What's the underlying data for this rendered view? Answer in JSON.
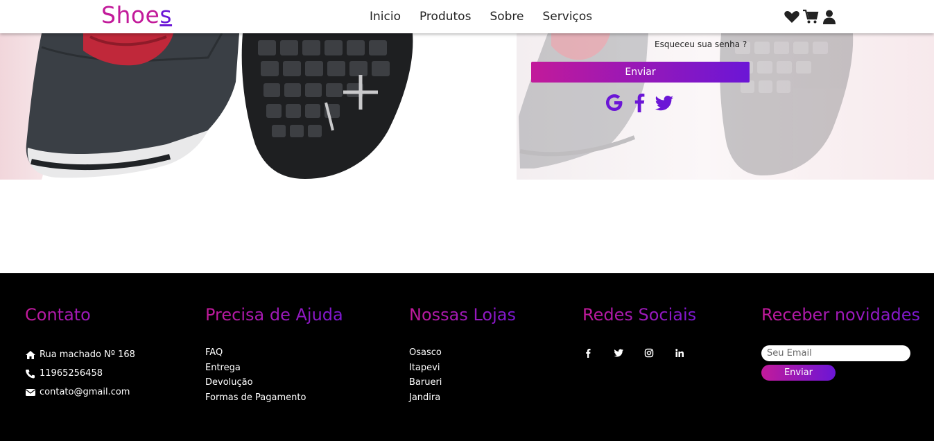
{
  "header": {
    "logo_main": "Shoe",
    "logo_last": "s",
    "nav": [
      "Inicio",
      "Produtos",
      "Sobre",
      "Serviços"
    ],
    "icons": [
      "heart-icon",
      "cart-icon",
      "user-icon"
    ]
  },
  "login": {
    "forgot_password": "Esqueceu sua senha ?",
    "submit_label": "Enviar",
    "social_icons": [
      "google-icon",
      "facebook-icon",
      "twitter-icon"
    ]
  },
  "footer": {
    "contact": {
      "title": "Contato",
      "address": "Rua machado Nº 168",
      "phone": "11965256458",
      "email": "contato@gmail.com"
    },
    "help": {
      "title": "Precisa de Ajuda",
      "items": [
        "FAQ",
        "Entrega",
        "Devolução",
        "Formas de Pagamento"
      ]
    },
    "stores": {
      "title": "Nossas Lojas",
      "items": [
        "Osasco",
        "Itapevi",
        "Barueri",
        "Jandira"
      ]
    },
    "social": {
      "title": "Redes Sociais",
      "icons": [
        "facebook-icon",
        "twitter-icon",
        "instagram-icon",
        "linkedin-icon"
      ]
    },
    "newsletter": {
      "title": "Receber novidades",
      "placeholder": "Seu Email",
      "button_label": "Enviar"
    }
  },
  "colors": {
    "accent_pink": "#c21a9a",
    "accent_purple": "#6b16d6",
    "footer_bg": "#000000"
  }
}
